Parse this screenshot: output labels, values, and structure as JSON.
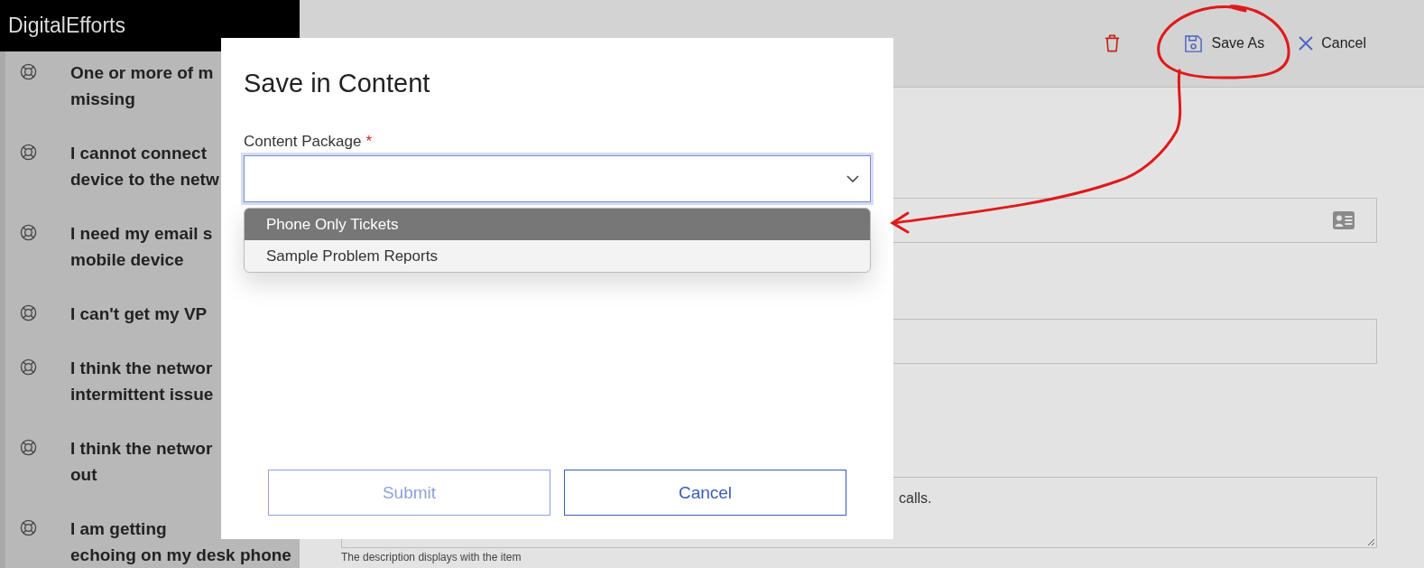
{
  "app": {
    "brand": "DigitalEfforts"
  },
  "sidebar": {
    "items": [
      {
        "lines": [
          "One or more of m",
          "missing"
        ]
      },
      {
        "lines": [
          "I cannot connect",
          "device to the netw"
        ]
      },
      {
        "lines": [
          "I need my email s",
          "mobile device"
        ]
      },
      {
        "lines": [
          "I can't get my VP"
        ]
      },
      {
        "lines": [
          "I think the networ",
          "intermittent issue"
        ]
      },
      {
        "lines": [
          "I think the networ",
          "out"
        ]
      },
      {
        "lines": [
          "I am getting",
          "echoing on my desk phone"
        ]
      }
    ]
  },
  "toolbar": {
    "actions": [
      {
        "kind": "delete"
      },
      {
        "kind": "save_as",
        "label": "Save As"
      },
      {
        "kind": "cancel",
        "label": "Cancel"
      }
    ]
  },
  "form": {
    "fields": [
      {
        "kind": "lookup"
      },
      {
        "kind": "text"
      },
      {
        "kind": "textarea",
        "value": "calls."
      }
    ],
    "hint": "The description displays with the item"
  },
  "dialog": {
    "title": "Save in Content",
    "field": {
      "label": "Content Package",
      "required": true,
      "required_mark": "*"
    },
    "options": [
      {
        "label": "Phone Only Tickets",
        "selected": true
      },
      {
        "label": "Sample Problem Reports",
        "selected": false
      }
    ],
    "buttons": [
      {
        "label": "Submit",
        "disabled": true
      },
      {
        "label": "Cancel",
        "disabled": false
      }
    ]
  }
}
